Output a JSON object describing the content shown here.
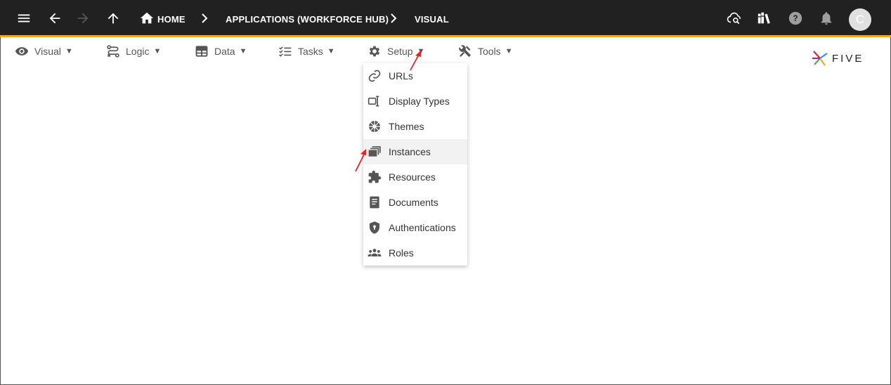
{
  "topbar": {
    "breadcrumbs": [
      {
        "label": "HOME"
      },
      {
        "label": "APPLICATIONS (WORKFORCE HUB)"
      },
      {
        "label": "VISUAL"
      }
    ],
    "avatar_initial": "C"
  },
  "menubar": {
    "items": [
      {
        "label": "Visual",
        "icon": "eye-icon"
      },
      {
        "label": "Logic",
        "icon": "flow-icon"
      },
      {
        "label": "Data",
        "icon": "table-icon"
      },
      {
        "label": "Tasks",
        "icon": "checklist-icon"
      },
      {
        "label": "Setup",
        "icon": "gear-icon"
      },
      {
        "label": "Tools",
        "icon": "tools-icon"
      }
    ],
    "caret": "▼"
  },
  "logo": {
    "text": "FIVE"
  },
  "setup_menu": {
    "items": [
      {
        "label": "URLs",
        "icon": "link-icon"
      },
      {
        "label": "Display Types",
        "icon": "display-type-icon"
      },
      {
        "label": "Themes",
        "icon": "theme-icon"
      },
      {
        "label": "Instances",
        "icon": "instances-icon"
      },
      {
        "label": "Resources",
        "icon": "puzzle-icon"
      },
      {
        "label": "Documents",
        "icon": "document-icon"
      },
      {
        "label": "Authentications",
        "icon": "shield-icon"
      },
      {
        "label": "Roles",
        "icon": "people-icon"
      }
    ],
    "highlighted": "Instances"
  },
  "colors": {
    "topbar": "#212121",
    "accent": "#f5a623",
    "annotation": "#e8231f"
  }
}
